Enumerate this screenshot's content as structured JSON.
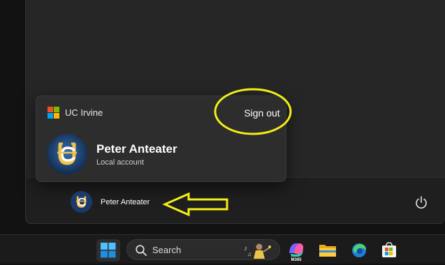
{
  "flyout": {
    "org_name": "UC Irvine",
    "sign_out_label": "Sign out",
    "account_name": "Peter Anteater",
    "account_type": "Local account"
  },
  "start_footer": {
    "user_name": "Peter Anteater",
    "power_icon": "power-icon"
  },
  "taskbar": {
    "search_label": "Search",
    "apps": [
      {
        "name": "start-button",
        "icon": "windows-logo"
      },
      {
        "name": "m365-app",
        "icon": "m365-copilot-icon",
        "badge": "M365"
      },
      {
        "name": "file-explorer",
        "icon": "folder-icon"
      },
      {
        "name": "edge-browser",
        "icon": "edge-icon"
      },
      {
        "name": "microsoft-store",
        "icon": "store-icon"
      }
    ]
  },
  "colors": {
    "annotation": "#f5ef16",
    "uci_blue": "#1b3a6b",
    "uci_gold": "#f3c34a",
    "ms_red": "#f25022",
    "ms_green": "#7fba00",
    "ms_blue": "#00a4ef",
    "ms_yellow": "#ffb900"
  }
}
